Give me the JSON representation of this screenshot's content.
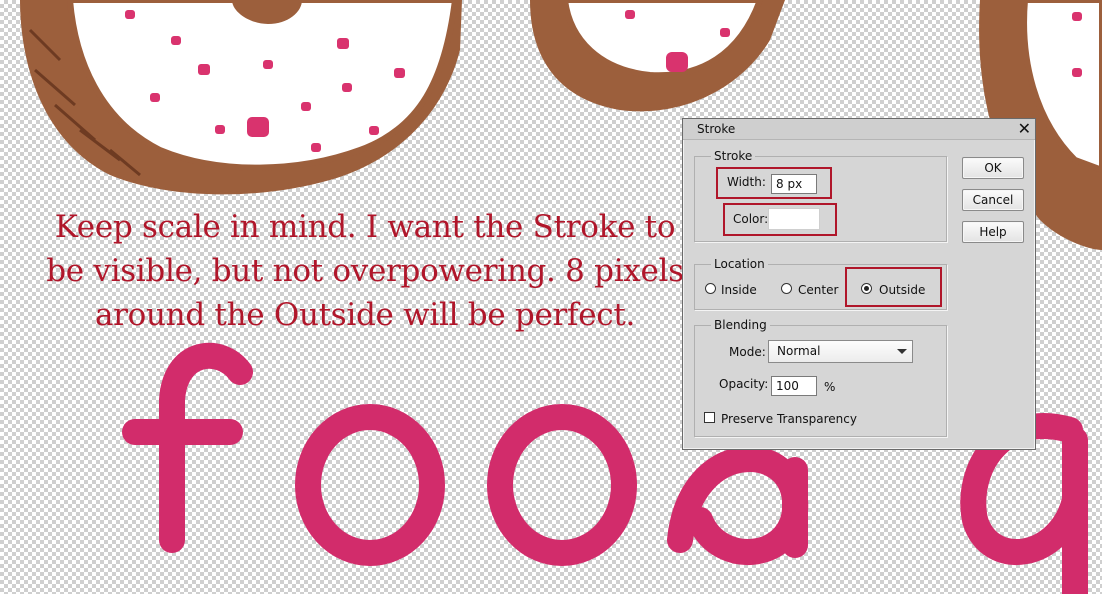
{
  "caption": {
    "line1": "Keep scale in mind. I want the Stroke to",
    "line2": "be visible, but not overpowering. 8 pixels",
    "line3": "around the Outside will be perfect."
  },
  "artwork": {
    "word": "food",
    "donut_brown": "#9c5f3c",
    "sprinkle_pink": "#d9336e",
    "letter_pink": "#d22c6b"
  },
  "dialog": {
    "title": "Stroke",
    "close_icon": "close-icon",
    "buttons": {
      "ok": "OK",
      "cancel": "Cancel",
      "help": "Help"
    },
    "stroke_group": {
      "label": "Stroke",
      "width_label": "Width:",
      "width_value": "8 px",
      "color_label": "Color:",
      "color_value": "#ffffff"
    },
    "location_group": {
      "label": "Location",
      "options": [
        "Inside",
        "Center",
        "Outside"
      ],
      "selected": "Outside"
    },
    "blending_group": {
      "label": "Blending",
      "mode_label": "Mode:",
      "mode_value": "Normal",
      "opacity_label": "Opacity:",
      "opacity_value": "100",
      "opacity_unit": "%",
      "preserve_label": "Preserve Transparency",
      "preserve_checked": false
    },
    "highlight_color": "#b0162a"
  }
}
